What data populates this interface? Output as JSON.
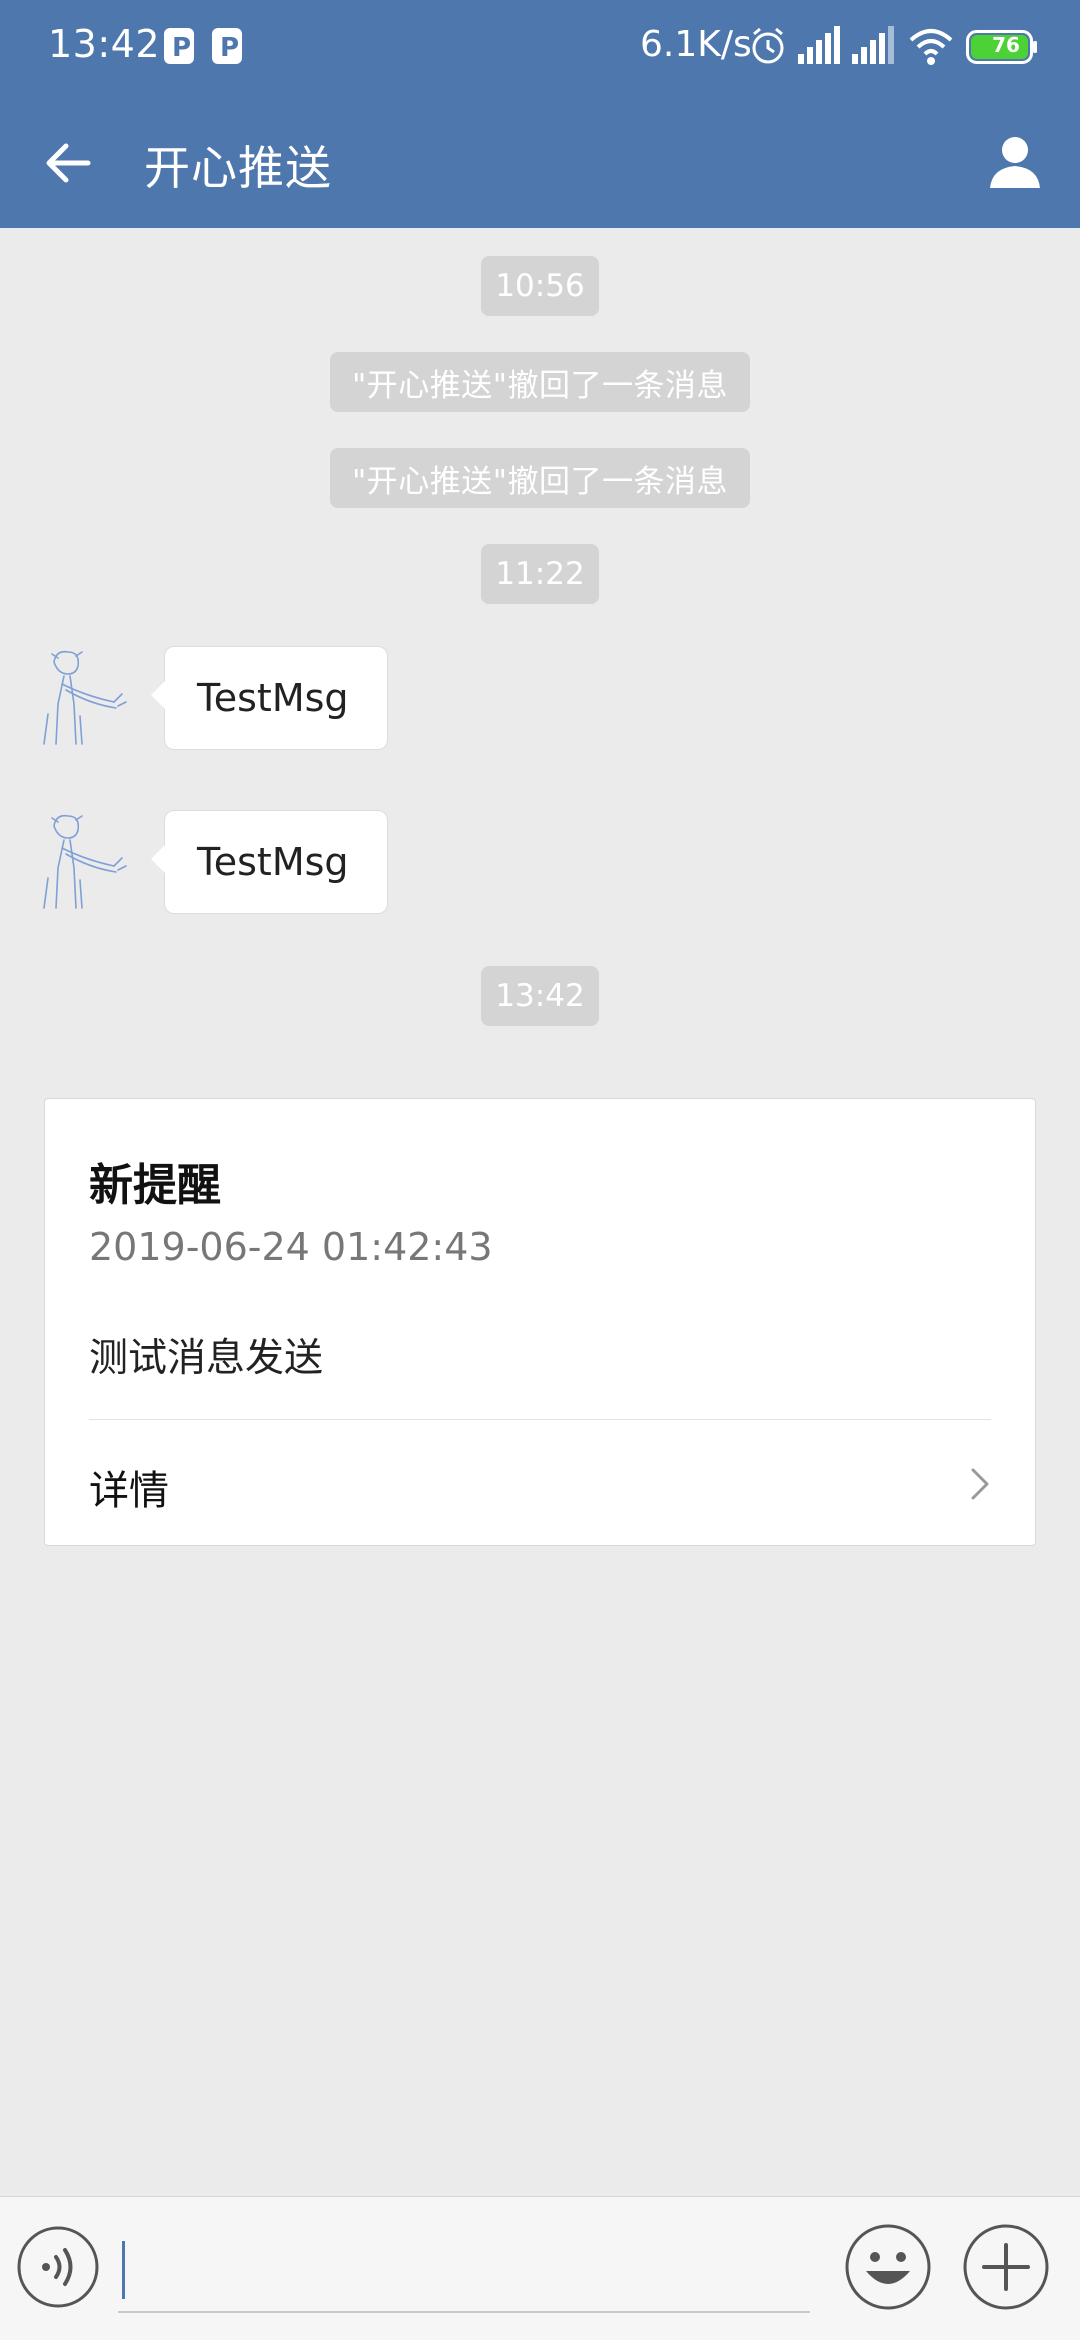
{
  "status_bar": {
    "time": "13:42",
    "speed": "6.1K/s",
    "battery": "76",
    "icons": [
      "parking-icon",
      "parking-icon",
      "alarm-icon",
      "signal-icon",
      "signal-icon",
      "wifi-icon",
      "battery-icon"
    ]
  },
  "header": {
    "title": "开心推送",
    "back_icon": "back-arrow-icon",
    "profile_icon": "person-icon"
  },
  "messages": [
    {
      "type": "time",
      "text": "10:56"
    },
    {
      "type": "notice",
      "text": "\"开心推送\"撤回了一条消息"
    },
    {
      "type": "notice",
      "text": "\"开心推送\"撤回了一条消息"
    },
    {
      "type": "time",
      "text": "11:22"
    },
    {
      "type": "incoming",
      "text": "TestMsg"
    },
    {
      "type": "incoming",
      "text": "TestMsg"
    },
    {
      "type": "time",
      "text": "13:42"
    }
  ],
  "card": {
    "title": "新提醒",
    "date": "2019-06-24 01:42:43",
    "body": "测试消息发送",
    "detail_label": "详情"
  },
  "input_bar": {
    "placeholder": "",
    "voice_icon": "voice-icon",
    "emoji_icon": "emoji-icon",
    "plus_icon": "plus-icon"
  },
  "colors": {
    "brand": "#4e78ad",
    "background": "#ebebeb",
    "chip": "#d4d4d4",
    "battery_fill": "#4cd137"
  }
}
